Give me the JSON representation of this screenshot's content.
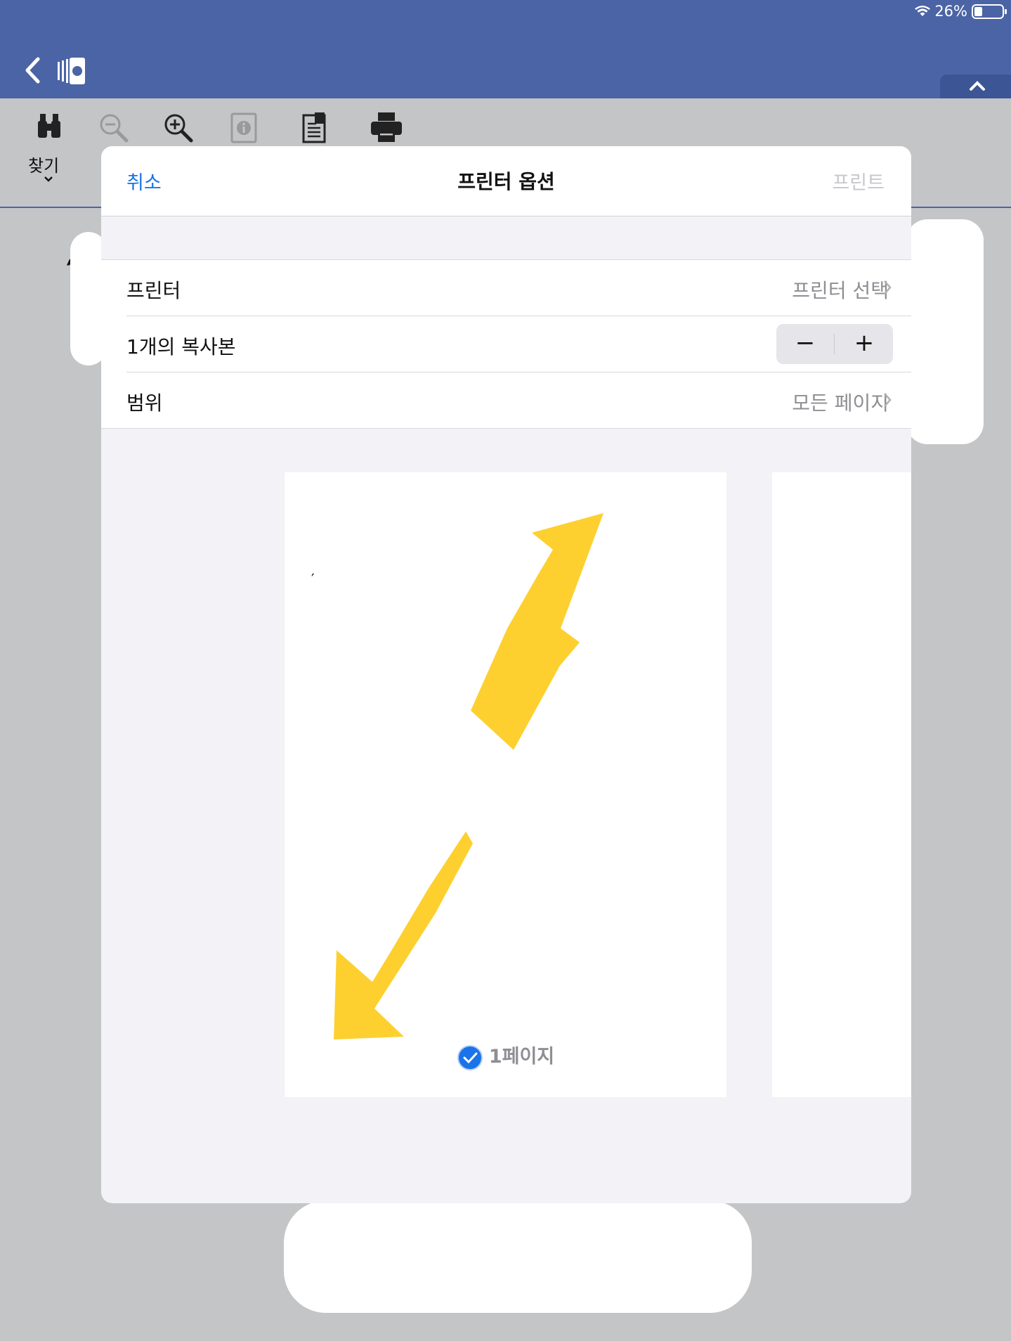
{
  "status_bar": {
    "battery": "26%",
    "battery_level": 0.26
  },
  "toolbar": {
    "find_label": "찾기"
  },
  "dialog": {
    "cancel": "취소",
    "title": "프린터 옵션",
    "print": "프린트",
    "rows": {
      "printer_label": "프린터",
      "printer_value": "프린터 선택",
      "copies_label": "1개의 복사본",
      "range_label": "범위",
      "range_value": "모든 페이지"
    },
    "stepper": {
      "minus": "−",
      "plus": "+"
    },
    "preview": {
      "page_label": "1페이지",
      "mark": "′"
    }
  },
  "background_text": "′′",
  "colors": {
    "top_bar": "#4a64a5",
    "accent": "#1a73e8",
    "annotation_arrow": "#fdd030"
  }
}
